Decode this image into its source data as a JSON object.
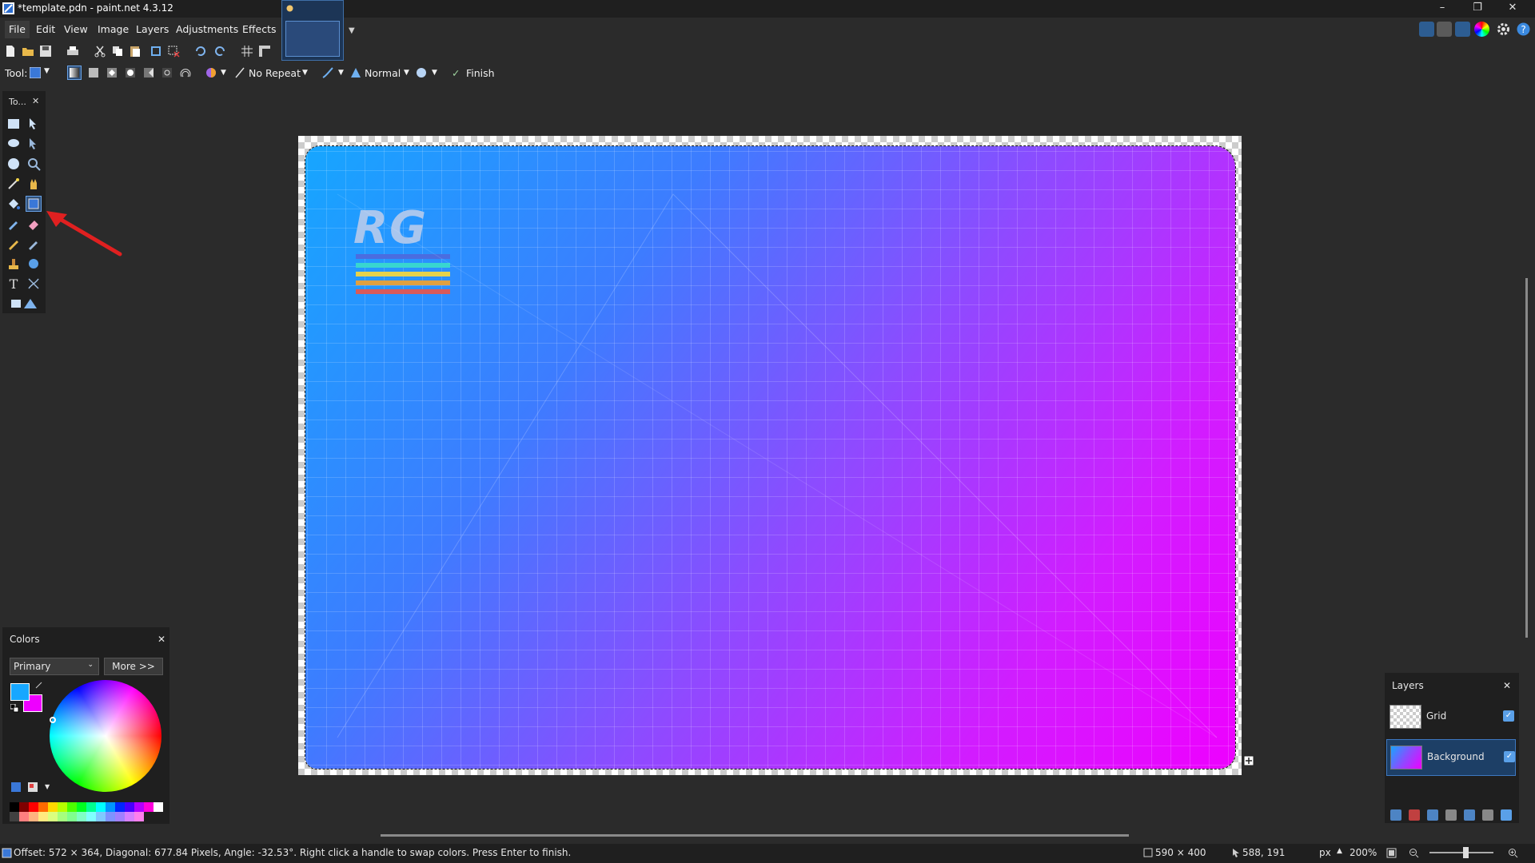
{
  "window": {
    "title": "*template.pdn - paint.net 4.3.12",
    "minimize": "–",
    "restore": "❐",
    "close": "✕"
  },
  "menu": {
    "items": [
      "File",
      "Edit",
      "View",
      "Image",
      "Layers",
      "Adjustments",
      "Effects"
    ]
  },
  "toolbar": {
    "tool_label": "Tool:",
    "repeat_mode": "No Repeat",
    "blend_mode": "Normal",
    "finish_label": "Finish"
  },
  "tools_panel": {
    "title": "To...",
    "close": "✕"
  },
  "canvas": {
    "logo_text": "RG",
    "stripe_colors": [
      "#4a6de0",
      "#38d6d0",
      "#e6d24a",
      "#e0a040",
      "#d85a5a"
    ]
  },
  "colors_panel": {
    "title": "Colors",
    "close": "✕",
    "mode": "Primary",
    "more_label": "More >>",
    "primary_color": "#17a7ff",
    "secondary_color": "#ee00ff",
    "palette": [
      "#000000",
      "#7f0000",
      "#ff0000",
      "#ff6a00",
      "#ffd800",
      "#b6ff00",
      "#4cff00",
      "#00ff21",
      "#00ff90",
      "#00ffff",
      "#0094ff",
      "#0026ff",
      "#4800ff",
      "#b200ff",
      "#ff00dc",
      "#ffffff",
      "#404040",
      "#ff7f7f",
      "#ffb27f",
      "#ffe97f",
      "#daff7f",
      "#a5ff7f",
      "#7fff8e",
      "#7fffc5",
      "#7fffff",
      "#7fc9ff",
      "#7f92ff",
      "#a17fff",
      "#d67fff",
      "#ff7fed"
    ]
  },
  "layers_panel": {
    "title": "Layers",
    "close": "✕",
    "layers": [
      {
        "name": "Grid",
        "visible": true
      },
      {
        "name": "Background",
        "visible": true
      }
    ]
  },
  "status": {
    "message": "Offset: 572 × 364, Diagonal: 677.84 Pixels, Angle: -32.53°. Right click a handle to swap colors. Press Enter to finish.",
    "image_size": "590 × 400",
    "cursor_position": "588, 191",
    "units": "px",
    "zoom": "200%"
  }
}
